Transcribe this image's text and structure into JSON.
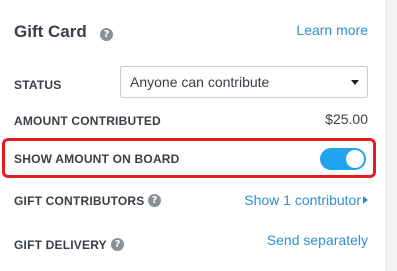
{
  "header": {
    "title": "Gift Card",
    "help_icon": "question-circle-icon",
    "learn_more": "Learn more"
  },
  "status": {
    "label": "STATUS",
    "selected": "Anyone can contribute",
    "caret_icon": "caret-down-icon"
  },
  "amount": {
    "label": "AMOUNT CONTRIBUTED",
    "value": "$25.00"
  },
  "show_amount": {
    "label": "SHOW AMOUNT ON BOARD",
    "enabled": true,
    "highlight_color": "#e41e1e",
    "toggle_color": "#20a4ef"
  },
  "contributors": {
    "label": "GIFT CONTRIBUTORS",
    "help_icon": "question-circle-icon",
    "link": "Show 1 contributor",
    "link_icon": "caret-right-icon"
  },
  "delivery": {
    "label": "GIFT DELIVERY",
    "help_icon": "question-circle-icon",
    "link": "Send separately"
  },
  "colors": {
    "link": "#2f8fd1",
    "text": "#3a3f45"
  }
}
